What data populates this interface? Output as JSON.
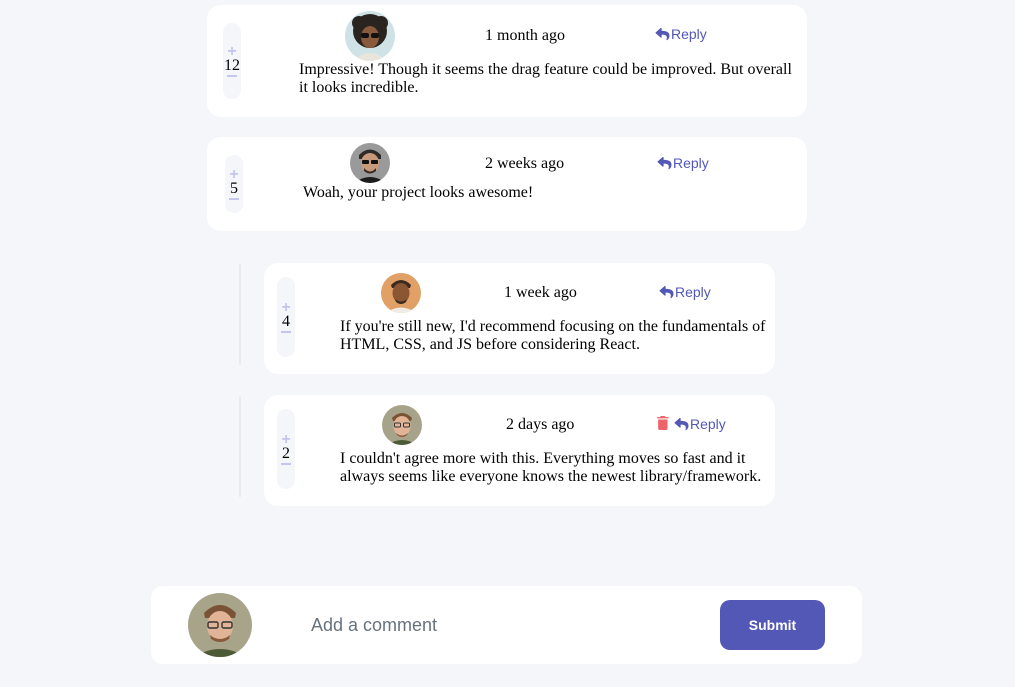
{
  "comments": [
    {
      "score": "12",
      "time": "1 month ago",
      "reply_label": "Reply",
      "text": "Impressive! Though it seems the drag feature could be improved. But overall it looks incredible."
    },
    {
      "score": "5",
      "time": "2 weeks ago",
      "reply_label": "Reply",
      "text": "Woah, your project looks awesome!"
    }
  ],
  "replies": [
    {
      "score": "4",
      "time": "1 week ago",
      "reply_label": "Reply",
      "text": "If you're still new, I'd recommend focusing on the fundamentals of HTML, CSS, and JS before considering React."
    },
    {
      "score": "2",
      "time": "2 days ago",
      "reply_label": "Reply",
      "text": "I couldn't agree more with this. Everything moves so fast and it always seems like everyone knows the newest library/framework."
    }
  ],
  "compose": {
    "placeholder": "Add a comment",
    "submit_label": "Submit"
  },
  "vote": {
    "plus": "+"
  },
  "icons": {
    "reply": "reply-arrow-icon",
    "delete": "trash-icon"
  },
  "colors": {
    "accent": "#5357b6",
    "delete": "#ed6368",
    "background": "#f5f6fa",
    "vote_control": "#c5c6ef"
  }
}
